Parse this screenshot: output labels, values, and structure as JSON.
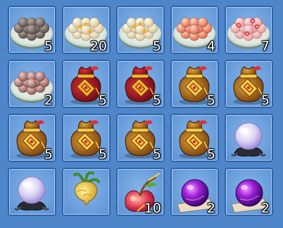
{
  "inventory": {
    "slots": [
      {
        "icon": "plate-sesame-dumplings-icon",
        "count": "5"
      },
      {
        "icon": "plate-star-dumplings-icon",
        "count": "20"
      },
      {
        "icon": "plate-star-dumplings-icon",
        "count": "5"
      },
      {
        "icon": "plate-peach-dumplings-icon",
        "count": "4"
      },
      {
        "icon": "plate-flower-dumplings-icon",
        "count": "7"
      },
      {
        "icon": "plate-pink-dumplings-icon",
        "count": "2"
      },
      {
        "icon": "red-lucky-bag-icon",
        "count": "5"
      },
      {
        "icon": "red-lucky-bag-icon",
        "count": "5"
      },
      {
        "icon": "gold-lucky-bag-icon",
        "count": "5"
      },
      {
        "icon": "gold-lucky-bag-icon",
        "count": "5"
      },
      {
        "icon": "gold-lucky-bag-icon",
        "count": "5"
      },
      {
        "icon": "gold-lucky-bag-icon",
        "count": "5"
      },
      {
        "icon": "gold-lucky-bag-icon",
        "count": "5"
      },
      {
        "icon": "gold-lucky-bag-icon",
        "count": "5"
      },
      {
        "icon": "crystal-orb-stand-icon",
        "count": ""
      },
      {
        "icon": "crystal-orb-stand-icon",
        "count": ""
      },
      {
        "icon": "golden-radish-icon",
        "count": ""
      },
      {
        "icon": "magic-peach-icon",
        "count": "10"
      },
      {
        "icon": "purple-orb-scroll-icon",
        "count": "2"
      },
      {
        "icon": "purple-orb-scroll-icon",
        "count": "2"
      }
    ]
  }
}
